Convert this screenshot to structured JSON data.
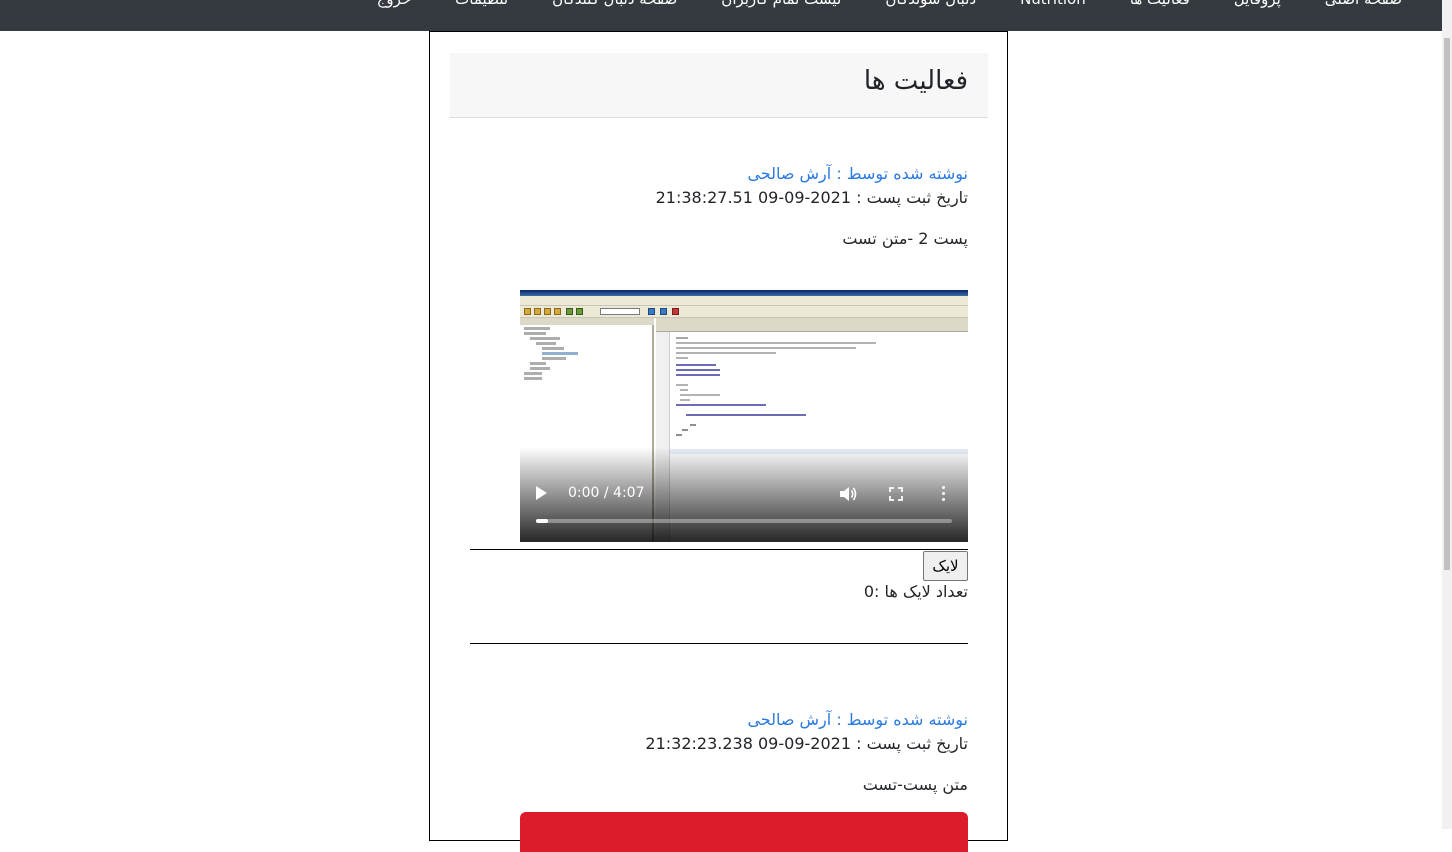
{
  "navbar": {
    "items": [
      "صفحه اصلی",
      "پروفایل",
      "فعالیت ها",
      "Nutrition",
      "دنبال شوندگان",
      "لیست تمام کاربران",
      "صفحه دنبال کنندگان",
      "تنظیمات",
      "خروج"
    ]
  },
  "page": {
    "title": "فعالیت ها"
  },
  "posts": [
    {
      "author": "نوشته شده توسط : آرش صالحی",
      "date": "تاریخ ثبت پست : 2021-09-09 21:38:27.51",
      "text": "پست 2 -متن تست",
      "video": {
        "time": "0:00 / 4:07",
        "progress": 0.03
      },
      "like_label": "لایک",
      "like_count": "تعداد لایک ها :0"
    },
    {
      "author": "نوشته شده توسط : آرش صالحی",
      "date": "تاریخ ثبت پست : 2021-09-09 21:32:23.238",
      "text": "متن پست-تست",
      "media_color": "#dc1c2b"
    }
  ],
  "colors": {
    "navbar_bg": "#343a40",
    "link": "#2a7ae2",
    "header_bg": "#f7f7f7"
  }
}
